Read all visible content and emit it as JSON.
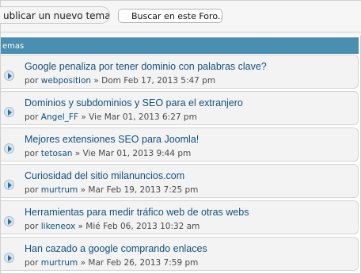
{
  "toolbar": {
    "post_button_label": "ublicar un nuevo tema",
    "search_label": "Buscar en este Foro..."
  },
  "section": {
    "title": "emas"
  },
  "topics": [
    {
      "title": "Google penaliza por tener dominio con palabras clave?",
      "by": "por",
      "author": "webposition",
      "date": "» Dom Feb 17, 2013 5:47 pm"
    },
    {
      "title": "Dominios y subdominios y SEO para el extranjero",
      "by": "por",
      "author": "Angel_FF",
      "date": "» Vie Mar 01, 2013 6:27 pm"
    },
    {
      "title": "Mejores extensiones SEO para Joomla!",
      "by": "por",
      "author": "tetosan",
      "date": "» Vie Mar 01, 2013 9:44 pm"
    },
    {
      "title": "Curiosidad del sitio milanuncios.com",
      "by": "por",
      "author": "murtrum",
      "date": "» Mar Feb 19, 2013 7:25 pm"
    },
    {
      "title": "Herramientas para medir tráfico web de otras webs",
      "by": "por",
      "author": "likeneox",
      "date": "» Mié Feb 06, 2013 10:32 am"
    },
    {
      "title": "Han cazado a google comprando enlaces",
      "by": "por",
      "author": "murtrum",
      "date": "» Mar Feb 26, 2013 7:59 pm"
    }
  ]
}
